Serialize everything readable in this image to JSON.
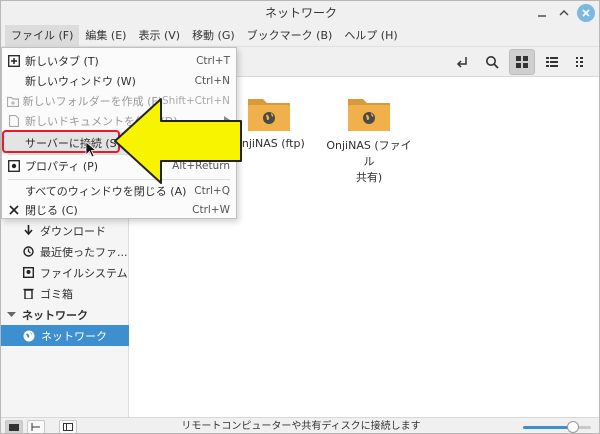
{
  "titlebar": {
    "title": "ネットワーク"
  },
  "menubar": {
    "items": [
      "ファイル (F)",
      "編集 (E)",
      "表示 (V)",
      "移動 (G)",
      "ブックマーク (B)",
      "ヘルプ (H)"
    ]
  },
  "file_menu": {
    "items": [
      {
        "label": "新しいタブ (T)",
        "accel": "Ctrl+T",
        "icon": "plus-box-icon",
        "enabled": true
      },
      {
        "label": "新しいウィンドウ (W)",
        "accel": "Ctrl+N",
        "enabled": true
      },
      {
        "label": "新しいフォルダーを作成 (F)",
        "accel": "Shift+Ctrl+N",
        "icon": "new-folder-icon",
        "enabled": false
      },
      {
        "label": "新しいドキュメントを作成 (D)",
        "accel": "",
        "icon": "new-document-icon",
        "enabled": false,
        "submenu": true
      },
      {
        "label": "サーバーに接続 (S)...",
        "accel": "",
        "enabled": true,
        "highlighted": true
      },
      {
        "label": "プロパティ (P)",
        "accel": "Alt+Return",
        "icon": "properties-icon",
        "enabled": true
      },
      {
        "label": "すべてのウィンドウを閉じる (A)",
        "accel": "Ctrl+Q",
        "enabled": true
      },
      {
        "label": "閉じる (C)",
        "accel": "Ctrl+W",
        "icon": "close-x-icon",
        "enabled": true
      }
    ]
  },
  "sidebar": {
    "items": [
      {
        "label": "ダウンロード",
        "icon": "download-icon"
      },
      {
        "label": "最近使ったファ...",
        "icon": "recent-clock-icon"
      },
      {
        "label": "ファイルシステム",
        "icon": "drive-icon"
      },
      {
        "label": "ゴミ箱",
        "icon": "trash-icon"
      }
    ],
    "network_heading": "ネットワーク",
    "network_item": "ネットワーク"
  },
  "content": {
    "folders": [
      {
        "label": "OnjiNAS (ftp)"
      },
      {
        "label": "OnjiNAS (ファイル共有)",
        "line1": "OnjiNAS (ファイル",
        "line2": "共有)"
      }
    ]
  },
  "statusbar": {
    "text": "リモートコンピューターや共有ディスクに接続します",
    "zoom_fraction": 0.72
  },
  "colors": {
    "accent": "#3d8fd0",
    "folder": "#f0b04c",
    "arrow_fill": "#f8f400",
    "highlight_border": "#e8192c"
  }
}
